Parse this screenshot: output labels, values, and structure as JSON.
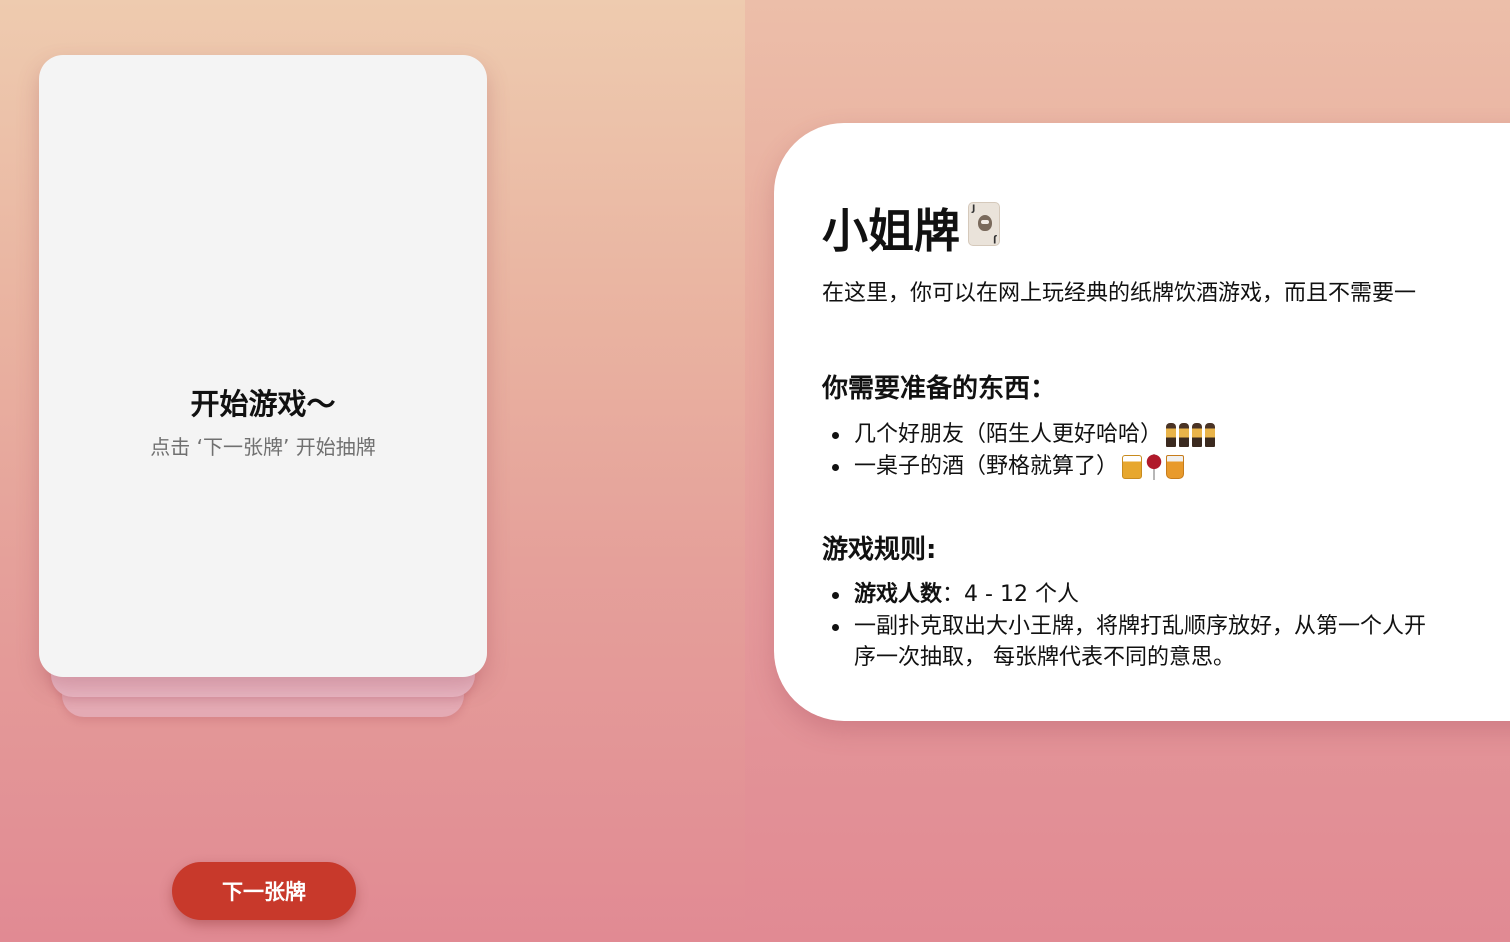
{
  "game": {
    "card_title": "开始游戏～",
    "card_hint": "点击 ‘下一张牌’ 开始抽牌",
    "next_button": "下一张牌"
  },
  "info": {
    "title": "小姐牌",
    "title_icon": "joker-card-icon",
    "intro": "在这里，你可以在网上玩经典的纸牌饮酒游戏，而且不需要一",
    "prep_heading": "你需要准备的东西：",
    "prep_items": [
      {
        "text": "几个好朋友（陌生人更好哈哈）",
        "icons": [
          "dancer-icon",
          "dancer-icon",
          "dancer-icon",
          "dancer-icon"
        ]
      },
      {
        "text": "一桌子的酒（野格就算了）",
        "icons": [
          "beer-mug-icon",
          "wine-glass-icon",
          "tumbler-glass-icon"
        ]
      }
    ],
    "rules_heading": "游戏规则:",
    "rules_items": [
      {
        "label": "游戏人数",
        "sep": "：",
        "text": "4 - 12 个人"
      },
      {
        "text": "一副扑克取出大小王牌，将牌打乱顺序放好，从第一个人开",
        "continuation": "序一次抽取， 每张牌代表不同的意思。"
      }
    ]
  }
}
